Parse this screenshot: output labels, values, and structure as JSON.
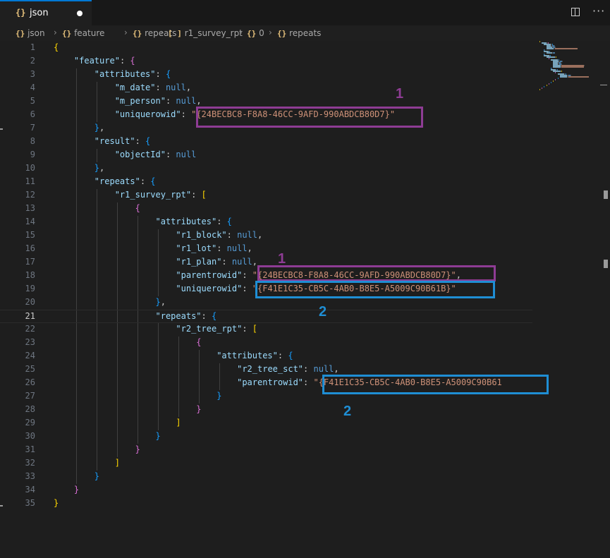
{
  "tab": {
    "icon": "{}",
    "label": "json",
    "modified": true
  },
  "toolbar": {
    "split_icon": "split-editor-icon",
    "more_label": "···"
  },
  "breadcrumb": [
    {
      "icon": "{}",
      "label": "json"
    },
    {
      "icon": "{}",
      "label": "feature"
    },
    {
      "icon": "{}",
      "label": "repeats"
    },
    {
      "icon": "[ ]",
      "label": "r1_survey_rpt"
    },
    {
      "icon": "{}",
      "label": "0"
    },
    {
      "icon": "{}",
      "label": "repeats"
    }
  ],
  "editor": {
    "active_line": 21,
    "lines": [
      {
        "n": "1",
        "tokens": [
          [
            "b1",
            "{"
          ]
        ]
      },
      {
        "n": "2",
        "tokens": [
          [
            "t",
            "    "
          ],
          [
            "k",
            "\"feature\""
          ],
          [
            "t",
            ": "
          ],
          [
            "b2",
            "{"
          ]
        ]
      },
      {
        "n": "3",
        "tokens": [
          [
            "t",
            "        "
          ],
          [
            "k",
            "\"attributes\""
          ],
          [
            "t",
            ": "
          ],
          [
            "b3",
            "{"
          ]
        ]
      },
      {
        "n": "4",
        "tokens": [
          [
            "t",
            "            "
          ],
          [
            "k",
            "\"m_date\""
          ],
          [
            "t",
            ": "
          ],
          [
            "n",
            "null"
          ],
          [
            "t",
            ","
          ]
        ]
      },
      {
        "n": "5",
        "tokens": [
          [
            "t",
            "            "
          ],
          [
            "k",
            "\"m_person\""
          ],
          [
            "t",
            ": "
          ],
          [
            "n",
            "null"
          ],
          [
            "t",
            ","
          ]
        ]
      },
      {
        "n": "6",
        "tokens": [
          [
            "t",
            "            "
          ],
          [
            "k",
            "\"uniquerowid\""
          ],
          [
            "t",
            ": "
          ],
          [
            "s",
            "\"{24BECBC8-F8A8-46CC-9AFD-990ABDCB80D7}\""
          ]
        ]
      },
      {
        "n": "7",
        "tokens": [
          [
            "t",
            "        "
          ],
          [
            "b3",
            "}"
          ],
          [
            "t",
            ","
          ]
        ]
      },
      {
        "n": "8",
        "tokens": [
          [
            "t",
            "        "
          ],
          [
            "k",
            "\"result\""
          ],
          [
            "t",
            ": "
          ],
          [
            "b3",
            "{"
          ]
        ]
      },
      {
        "n": "9",
        "tokens": [
          [
            "t",
            "            "
          ],
          [
            "k",
            "\"objectId\""
          ],
          [
            "t",
            ": "
          ],
          [
            "n",
            "null"
          ]
        ]
      },
      {
        "n": "10",
        "tokens": [
          [
            "t",
            "        "
          ],
          [
            "b3",
            "}"
          ],
          [
            "t",
            ","
          ]
        ]
      },
      {
        "n": "11",
        "tokens": [
          [
            "t",
            "        "
          ],
          [
            "k",
            "\"repeats\""
          ],
          [
            "t",
            ": "
          ],
          [
            "b3",
            "{"
          ]
        ]
      },
      {
        "n": "12",
        "tokens": [
          [
            "t",
            "            "
          ],
          [
            "k",
            "\"r1_survey_rpt\""
          ],
          [
            "t",
            ": "
          ],
          [
            "b1",
            "["
          ]
        ]
      },
      {
        "n": "13",
        "tokens": [
          [
            "t",
            "                "
          ],
          [
            "b2",
            "{"
          ]
        ]
      },
      {
        "n": "14",
        "tokens": [
          [
            "t",
            "                    "
          ],
          [
            "k",
            "\"attributes\""
          ],
          [
            "t",
            ": "
          ],
          [
            "b3",
            "{"
          ]
        ]
      },
      {
        "n": "15",
        "tokens": [
          [
            "t",
            "                        "
          ],
          [
            "k",
            "\"r1_block\""
          ],
          [
            "t",
            ": "
          ],
          [
            "n",
            "null"
          ],
          [
            "t",
            ","
          ]
        ]
      },
      {
        "n": "16",
        "tokens": [
          [
            "t",
            "                        "
          ],
          [
            "k",
            "\"r1_lot\""
          ],
          [
            "t",
            ": "
          ],
          [
            "n",
            "null"
          ],
          [
            "t",
            ","
          ]
        ]
      },
      {
        "n": "17",
        "tokens": [
          [
            "t",
            "                        "
          ],
          [
            "k",
            "\"r1_plan\""
          ],
          [
            "t",
            ": "
          ],
          [
            "n",
            "null"
          ],
          [
            "t",
            ","
          ]
        ]
      },
      {
        "n": "18",
        "tokens": [
          [
            "t",
            "                        "
          ],
          [
            "k",
            "\"parentrowid\""
          ],
          [
            "t",
            ": "
          ],
          [
            "s",
            "\"{24BECBC8-F8A8-46CC-9AFD-990ABDCB80D7}\""
          ],
          [
            "t",
            ","
          ]
        ]
      },
      {
        "n": "19",
        "tokens": [
          [
            "t",
            "                        "
          ],
          [
            "k",
            "\"uniquerowid\""
          ],
          [
            "t",
            ": "
          ],
          [
            "s",
            "\"{F41E1C35-CB5C-4AB0-B8E5-A5009C90B61B}\""
          ]
        ]
      },
      {
        "n": "20",
        "tokens": [
          [
            "t",
            "                    "
          ],
          [
            "b3",
            "}"
          ],
          [
            "t",
            ","
          ]
        ]
      },
      {
        "n": "21",
        "tokens": [
          [
            "t",
            "                    "
          ],
          [
            "k",
            "\"repeats\""
          ],
          [
            "t",
            ": "
          ],
          [
            "b3",
            "{"
          ]
        ]
      },
      {
        "n": "22",
        "tokens": [
          [
            "t",
            "                        "
          ],
          [
            "k",
            "\"r2_tree_rpt\""
          ],
          [
            "t",
            ": "
          ],
          [
            "b1",
            "["
          ]
        ]
      },
      {
        "n": "23",
        "tokens": [
          [
            "t",
            "                            "
          ],
          [
            "b2",
            "{"
          ]
        ]
      },
      {
        "n": "24",
        "tokens": [
          [
            "t",
            "                                "
          ],
          [
            "k",
            "\"attributes\""
          ],
          [
            "t",
            ": "
          ],
          [
            "b3",
            "{"
          ]
        ]
      },
      {
        "n": "25",
        "tokens": [
          [
            "t",
            "                                    "
          ],
          [
            "k",
            "\"r2_tree_sct\""
          ],
          [
            "t",
            ": "
          ],
          [
            "n",
            "null"
          ],
          [
            "t",
            ","
          ]
        ]
      },
      {
        "n": "26",
        "tokens": [
          [
            "t",
            "                                    "
          ],
          [
            "k",
            "\"parentrowid\""
          ],
          [
            "t",
            ": "
          ],
          [
            "s",
            "\"{F41E1C35-CB5C-4AB0-B8E5-A5009C90B61"
          ]
        ]
      },
      {
        "n": "27",
        "tokens": [
          [
            "t",
            "                                "
          ],
          [
            "b3",
            "}"
          ]
        ]
      },
      {
        "n": "28",
        "tokens": [
          [
            "t",
            "                            "
          ],
          [
            "b2",
            "}"
          ]
        ]
      },
      {
        "n": "29",
        "tokens": [
          [
            "t",
            "                        "
          ],
          [
            "b1",
            "]"
          ]
        ]
      },
      {
        "n": "30",
        "tokens": [
          [
            "t",
            "                    "
          ],
          [
            "b3",
            "}"
          ]
        ]
      },
      {
        "n": "31",
        "tokens": [
          [
            "t",
            "                "
          ],
          [
            "b2",
            "}"
          ]
        ]
      },
      {
        "n": "32",
        "tokens": [
          [
            "t",
            "            "
          ],
          [
            "b1",
            "]"
          ]
        ]
      },
      {
        "n": "33",
        "tokens": [
          [
            "t",
            "        "
          ],
          [
            "b3",
            "}"
          ]
        ]
      },
      {
        "n": "34",
        "tokens": [
          [
            "t",
            "    "
          ],
          [
            "b2",
            "}"
          ]
        ]
      },
      {
        "n": "35",
        "tokens": [
          [
            "b1",
            "}"
          ]
        ]
      }
    ]
  },
  "annotations": [
    {
      "label": "1",
      "color": "#8e3c94"
    },
    {
      "label": "1",
      "color": "#8e3c94"
    },
    {
      "label": "2",
      "color": "#1f8ed4"
    },
    {
      "label": "2",
      "color": "#1f8ed4"
    }
  ],
  "colors": {
    "key": "#9cdcfe",
    "string": "#ce9178",
    "null": "#569cd6",
    "bracket_gold": "#ffd700",
    "bracket_orchid": "#da70d6",
    "bracket_blue": "#179fff",
    "accent": "#0078d4"
  }
}
